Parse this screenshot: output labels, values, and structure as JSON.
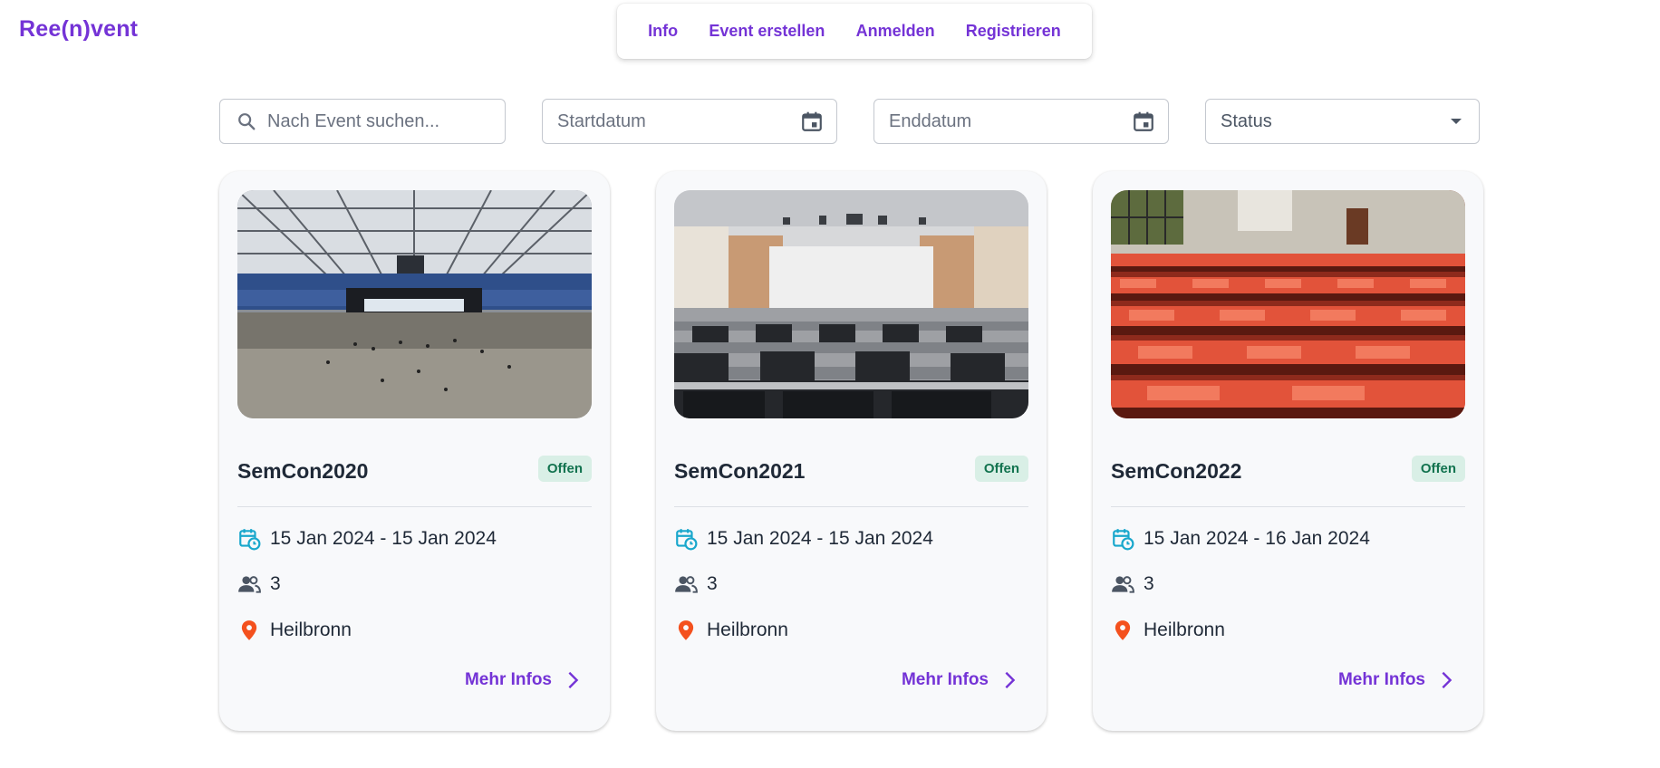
{
  "app": {
    "logo": "Ree(n)vent"
  },
  "nav": [
    {
      "label": "Info"
    },
    {
      "label": "Event erstellen"
    },
    {
      "label": "Anmelden"
    },
    {
      "label": "Registrieren"
    }
  ],
  "filters": {
    "search_placeholder": "Nach Event suchen...",
    "start_placeholder": "Startdatum",
    "end_placeholder": "Enddatum",
    "status_label": "Status"
  },
  "colors": {
    "brand": "#7433d6",
    "badge_bg": "#d9efe6",
    "badge_text": "#12734f",
    "calendar_icon": "#19a7cc",
    "location_icon": "#f4511e"
  },
  "events": [
    {
      "title": "SemCon2020",
      "status": "Offen",
      "dates": "15 Jan 2024 - 15 Jan 2024",
      "participants": "3",
      "location": "Heilbronn",
      "more_label": "Mehr Infos"
    },
    {
      "title": "SemCon2021",
      "status": "Offen",
      "dates": "15 Jan 2024 - 15 Jan 2024",
      "participants": "3",
      "location": "Heilbronn",
      "more_label": "Mehr Infos"
    },
    {
      "title": "SemCon2022",
      "status": "Offen",
      "dates": "15 Jan 2024 - 16 Jan 2024",
      "participants": "3",
      "location": "Heilbronn",
      "more_label": "Mehr Infos"
    }
  ]
}
